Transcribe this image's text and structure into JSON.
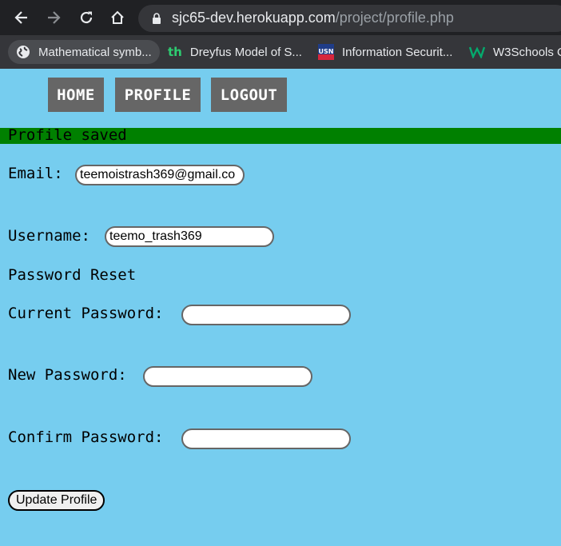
{
  "browser": {
    "url_host": "sjc65-dev.herokuapp.com",
    "url_path": "/project/profile.php",
    "bookmarks": [
      {
        "label": "Mathematical symb...",
        "icon": "globe-icon"
      },
      {
        "label": "Dreyfus Model of S...",
        "icon": "th-icon"
      },
      {
        "label": "Information Securit...",
        "icon": "usn-icon"
      },
      {
        "label": "W3Schools O",
        "icon": "w3-icon"
      }
    ]
  },
  "nav": {
    "home": "HOME",
    "profile": "PROFILE",
    "logout": "LOGOUT"
  },
  "flash": "Profile saved",
  "form": {
    "email_label": "Email:",
    "email_value": "teemoistrash369@gmail.co",
    "username_label": "Username:",
    "username_value": "teemo_trash369",
    "password_reset_heading": "Password Reset",
    "current_password_label": "Current Password:",
    "new_password_label": "New Password:",
    "confirm_password_label": "Confirm Password:",
    "submit_label": "Update Profile"
  },
  "colors": {
    "page_bg": "#76cdef",
    "flash_bg": "#008000",
    "nav_bg": "#666666"
  }
}
